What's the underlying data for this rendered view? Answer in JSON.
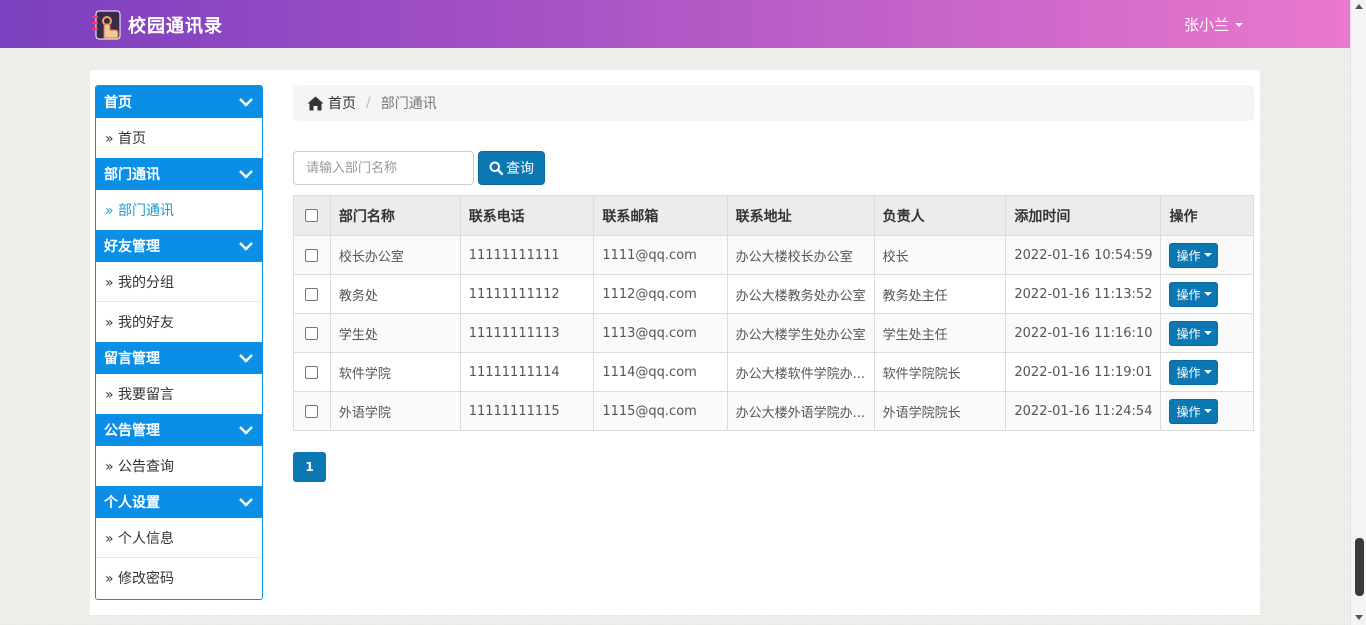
{
  "colors": {
    "header_start": "#7b3fbf",
    "header_end": "#ea78cc",
    "accent": "#0b8fe6",
    "button": "#0b78b4",
    "active_link": "#1a9ad6"
  },
  "header": {
    "app_title": "校园通讯录",
    "user_name": "张小兰",
    "logo_icon": "address-book-logo"
  },
  "sidebar": {
    "sections": [
      {
        "title": "首页",
        "items": [
          "» 首页"
        ]
      },
      {
        "title": "部门通讯",
        "items": [
          "» 部门通讯"
        ]
      },
      {
        "title": "好友管理",
        "items": [
          "» 我的分组",
          "» 我的好友"
        ]
      },
      {
        "title": "留言管理",
        "items": [
          "» 我要留言"
        ]
      },
      {
        "title": "公告管理",
        "items": [
          "» 公告查询"
        ]
      },
      {
        "title": "个人设置",
        "items": [
          "» 个人信息",
          "» 修改密码"
        ]
      }
    ],
    "active_item": "» 部门通讯"
  },
  "breadcrumb": {
    "home": "首页",
    "separator": "/",
    "current": "部门通讯"
  },
  "search": {
    "placeholder": "请输入部门名称",
    "value": "",
    "button_label": "查询"
  },
  "table": {
    "headers": [
      "部门名称",
      "联系电话",
      "联系邮箱",
      "联系地址",
      "负责人",
      "添加时间",
      "操作"
    ],
    "rows": [
      {
        "name": "校长办公室",
        "phone": "11111111111",
        "email": "1111@qq.com",
        "address": "办公大楼校长办公室",
        "manager": "校长",
        "time": "2022-01-16 10:54:59",
        "action": "操作"
      },
      {
        "name": "教务处",
        "phone": "11111111112",
        "email": "1112@qq.com",
        "address": "办公大楼教务处办公室",
        "manager": "教务处主任",
        "time": "2022-01-16 11:13:52",
        "action": "操作"
      },
      {
        "name": "学生处",
        "phone": "11111111113",
        "email": "1113@qq.com",
        "address": "办公大楼学生处办公室",
        "manager": "学生处主任",
        "time": "2022-01-16 11:16:10",
        "action": "操作"
      },
      {
        "name": "软件学院",
        "phone": "11111111114",
        "email": "1114@qq.com",
        "address": "办公大楼软件学院办...",
        "manager": "软件学院院长",
        "time": "2022-01-16 11:19:01",
        "action": "操作"
      },
      {
        "name": "外语学院",
        "phone": "11111111115",
        "email": "1115@qq.com",
        "address": "办公大楼外语学院办...",
        "manager": "外语学院院长",
        "time": "2022-01-16 11:24:54",
        "action": "操作"
      }
    ]
  },
  "pagination": {
    "current_page": "1"
  }
}
